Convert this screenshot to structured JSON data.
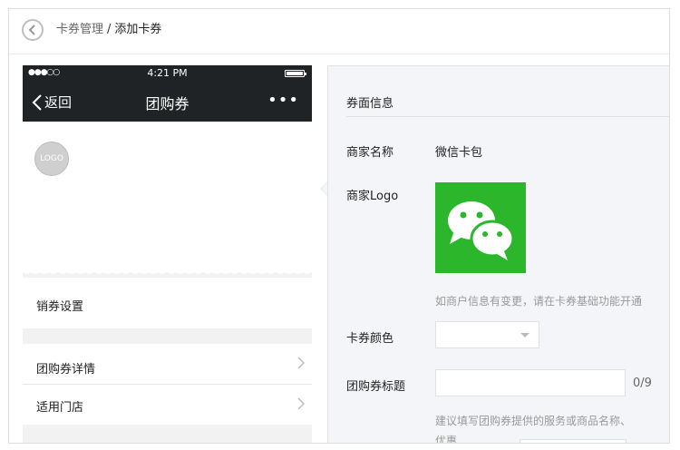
{
  "breadcrumb": {
    "parent": "卡券管理",
    "separator": "/",
    "current": "添加卡券"
  },
  "phone": {
    "status": {
      "signal": "●●●○○",
      "time": "4:21 PM"
    },
    "nav": {
      "back_label": "返回",
      "title": "团购券",
      "more": "•••"
    },
    "logo_placeholder": "LOGO",
    "rows": {
      "sales": "销券设置",
      "detail": "团购券详情",
      "stores": "适用门店"
    }
  },
  "form": {
    "section_title": "券面信息",
    "merchant_name_label": "商家名称",
    "merchant_name_value": "微信卡包",
    "merchant_logo_label": "商家Logo",
    "logo_hint": "如商户信息有变更，请在卡券基础功能开通",
    "color_label": "卡券颜色",
    "title_label": "团购券标题",
    "title_value": "",
    "title_counter": "0/9",
    "title_hint_line1": "建议填写团购券提供的服务或商品名称、",
    "title_hint_line2": "优惠"
  },
  "colors": {
    "nav_bg": "#1f2325",
    "wechat_green": "#2bb62b",
    "panel_bg": "#f4f5f9"
  }
}
